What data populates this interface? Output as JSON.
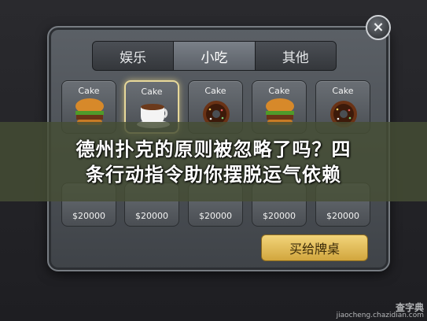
{
  "tabs": [
    {
      "label": "娱乐",
      "active": false
    },
    {
      "label": "小吃",
      "active": true
    },
    {
      "label": "其他",
      "active": false
    }
  ],
  "items_top": [
    {
      "label": "Cake",
      "icon": "burger-icon",
      "selected": false
    },
    {
      "label": "Cake",
      "icon": "coffee-cup-icon",
      "selected": true
    },
    {
      "label": "Cake",
      "icon": "donut-icon",
      "selected": false
    },
    {
      "label": "Cake",
      "icon": "burger-icon",
      "selected": false
    },
    {
      "label": "Cake",
      "icon": "donut-icon",
      "selected": false
    }
  ],
  "items_bottom": [
    {
      "price": "$20000",
      "icon": "burger-icon"
    },
    {
      "price": "$20000",
      "icon": "burger-icon"
    },
    {
      "price": "$20000",
      "icon": "donut-icon"
    },
    {
      "price": "$20000",
      "icon": "burger-icon"
    },
    {
      "price": "$20000",
      "icon": "donut-icon"
    }
  ],
  "buy_button": "买给牌桌",
  "close_icon": "×",
  "banner": {
    "line1": "德州扑克的原则被忽略了吗？四",
    "line2": "条行动指令助你摆脱运气依赖"
  },
  "watermark": {
    "line1": "查字典",
    "line2": "jiaocheng.chazidian.com"
  },
  "colors": {
    "accent_gold": "#e7d89a",
    "button_gold": "#d2a63e",
    "panel": "#4a4e53"
  }
}
